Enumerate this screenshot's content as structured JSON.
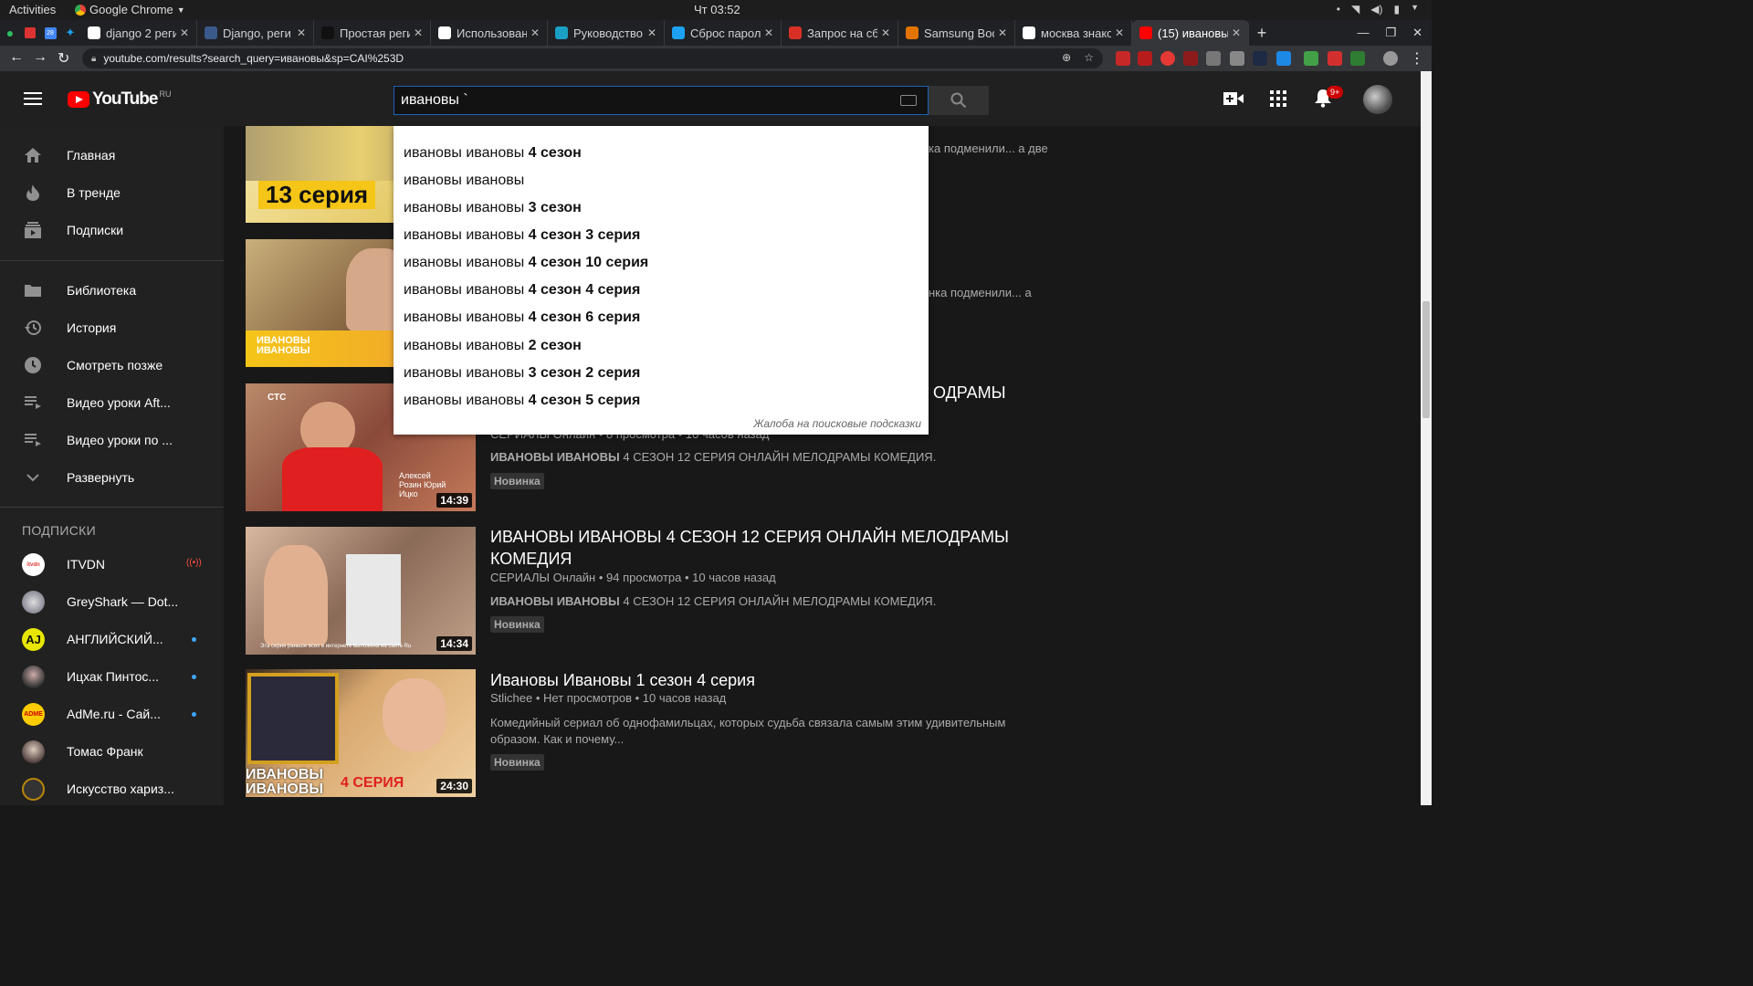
{
  "os": {
    "activities": "Activities",
    "app_name": "Google Chrome",
    "clock": "Чт 03:52"
  },
  "tabs": [
    {
      "title": "django 2 реги",
      "favicon_color": "#ffffff"
    },
    {
      "title": "Django, реги",
      "favicon_color": "#3a5a8c"
    },
    {
      "title": "Простая реги",
      "favicon_color": "#111111"
    },
    {
      "title": "Использован",
      "favicon_color": "#ffffff"
    },
    {
      "title": "Руководство",
      "favicon_color": "#1aa0c4"
    },
    {
      "title": "Сброс парол",
      "favicon_color": "#1da1f2"
    },
    {
      "title": "Запрос на сб",
      "favicon_color": "#d93025"
    },
    {
      "title": "Samsung Boo",
      "favicon_color": "#e37400"
    },
    {
      "title": "москва знако",
      "favicon_color": "#ffffff"
    },
    {
      "title": "(15) ивановы",
      "favicon_color": "#ff0000"
    }
  ],
  "url": "youtube.com/results?search_query=ивановы&sp=CAI%253D",
  "masthead": {
    "logo_text": "YouTube",
    "logo_region": "RU",
    "search_value": "ивановы `",
    "notif_count": "9+"
  },
  "sidebar": {
    "main": [
      {
        "label": "Главная",
        "icon": "home-icon"
      },
      {
        "label": "В тренде",
        "icon": "trending-icon"
      },
      {
        "label": "Подписки",
        "icon": "subscriptions-icon"
      }
    ],
    "library": [
      {
        "label": "Библиотека",
        "icon": "library-icon"
      },
      {
        "label": "История",
        "icon": "history-icon"
      },
      {
        "label": "Смотреть позже",
        "icon": "watch-later-icon"
      },
      {
        "label": "Видео уроки Aft...",
        "icon": "playlist-icon"
      },
      {
        "label": "Видео уроки по ...",
        "icon": "playlist-icon"
      },
      {
        "label": "Развернуть",
        "icon": "chevron-down-icon"
      }
    ],
    "subs_header": "ПОДПИСКИ",
    "subs": [
      {
        "label": "ITVDN",
        "av_text": "itvdn",
        "status": "live"
      },
      {
        "label": "GreyShark — Dot...",
        "av_text": "",
        "status": "none"
      },
      {
        "label": "АНГЛИЙСКИЙ...",
        "av_text": "AJ",
        "status": "new"
      },
      {
        "label": "Ицхак Пинтос...",
        "av_text": "",
        "status": "new"
      },
      {
        "label": "AdMe.ru - Сай...",
        "av_text": "ADME",
        "status": "new"
      },
      {
        "label": "Томас Франк",
        "av_text": "",
        "status": "none"
      },
      {
        "label": "Искусство хариз...",
        "av_text": "",
        "status": "none"
      }
    ]
  },
  "suggestions": {
    "prefix": "ивановы ивановы",
    "items": [
      " 4 сезон",
      "",
      " 3 сезон",
      " 4 сезон 3 серия",
      " 4 сезон 10 серия",
      " 4 сезон 4 серия",
      " 4 сезон 6 серия",
      " 2 сезон",
      " 3 сезон 2 серия",
      " 4 сезон 5 серия"
    ],
    "report": "Жалоба на поисковые подсказки"
  },
  "results": {
    "partial_1": "ка подменили... а две",
    "partial_2": "нка подменили... а",
    "partial_3_title": "ОДРАМЫ",
    "partial_3_meta": "СЕРИАЛЫ Онлайн • 8 просмотра • 10 часов назад",
    "thumb1_text": "13 серия",
    "thumb2_text": "ИВАНОВЫ ИВАНОВЫ",
    "thumb3_text": "Алексей Розин Юрий Ицко",
    "thumb3_logo": "СТС",
    "thumb4_text": "Эта серия раньше всех в интернете выложена на сайте Ru",
    "thumb5_text_a": "ИВАНОВЫ ИВАНОВЫ",
    "thumb5_text_b": "4 СЕРИЯ",
    "video3": {
      "duration": "14:39",
      "desc_bold": "ИВАНОВЫ ИВАНОВЫ",
      "desc": " 4 СЕЗОН 12 СЕРИЯ ОНЛАЙН МЕЛОДРАМЫ КОМЕДИЯ.",
      "badge": "Новинка"
    },
    "video4": {
      "title": "ИВАНОВЫ ИВАНОВЫ 4 СЕЗОН 12 СЕРИЯ ОНЛАЙН МЕЛОДРАМЫ КОМЕДИЯ",
      "meta": "СЕРИАЛЫ Онлайн • 94 просмотра • 10 часов назад",
      "duration": "14:34",
      "desc_bold": "ИВАНОВЫ ИВАНОВЫ",
      "desc": " 4 СЕЗОН 12 СЕРИЯ ОНЛАЙН МЕЛОДРАМЫ КОМЕДИЯ.",
      "badge": "Новинка"
    },
    "video5": {
      "title": "Ивановы Ивановы 1 сезон 4 серия",
      "meta": "Stlichee • Нет просмотров • 10 часов назад",
      "duration": "24:30",
      "desc": "Комедийный сериал об однофамильцах, которых судьба связала самым этим удивительным образом. Как и почему...",
      "badge": "Новинка"
    }
  }
}
